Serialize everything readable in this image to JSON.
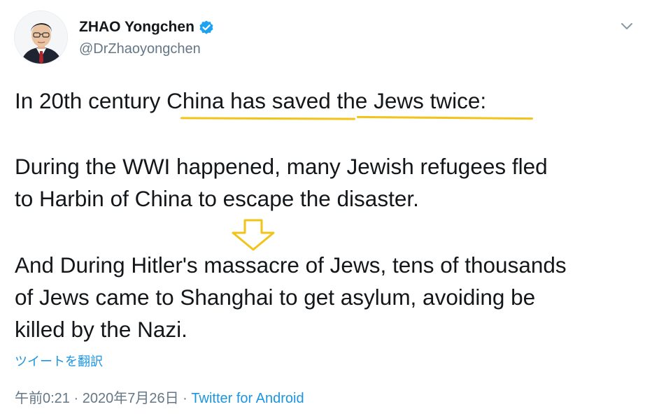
{
  "tweet": {
    "author_name": "ZHAO Yongchen",
    "handle": "@DrZhaoyongchen",
    "lines": [
      "In 20th century China has saved the Jews twice:",
      "During the WWI happened, many Jewish refugees fled",
      "to Harbin of China to escape the disaster.",
      "And During Hitler's massacre of Jews, tens of thousands",
      "of Jews came to Shanghai to get asylum, avoiding be",
      "killed by the Nazi."
    ],
    "translate_label": "ツイートを翻訳",
    "time": "午前0:21",
    "separator": "·",
    "date": "2020年7月26日",
    "source": "Twitter for Android"
  },
  "icons": {
    "verified": "verified-badge-icon",
    "caret": "chevron-down-icon",
    "arrow": "down-arrow-annotation"
  },
  "colors": {
    "text": "#14171a",
    "secondary": "#657786",
    "link": "#1b95e0",
    "verified": "#1da1f2",
    "annotation": "#f2c318"
  }
}
